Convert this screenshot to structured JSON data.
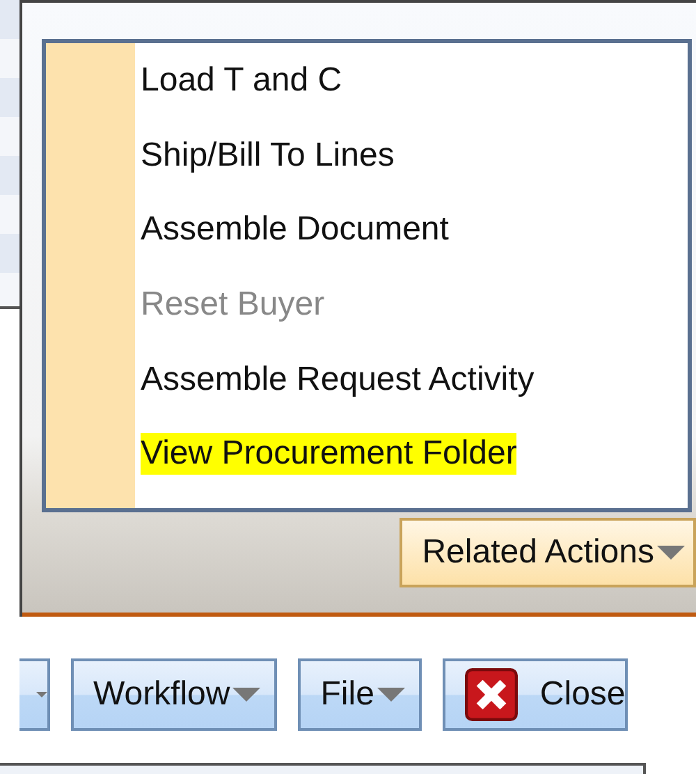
{
  "menu": {
    "items": [
      {
        "label": "Load T and C",
        "disabled": false,
        "highlighted": false
      },
      {
        "label": "Ship/Bill To Lines",
        "disabled": false,
        "highlighted": false
      },
      {
        "label": "Assemble Document",
        "disabled": false,
        "highlighted": false
      },
      {
        "label": "Reset Buyer",
        "disabled": true,
        "highlighted": false
      },
      {
        "label": "Assemble Request Activity",
        "disabled": false,
        "highlighted": false
      },
      {
        "label": "View Procurement Folder",
        "disabled": false,
        "highlighted": true
      }
    ]
  },
  "related_actions": {
    "label": "Related Actions",
    "expanded": true
  },
  "toolbar_buttons": [
    {
      "kind": "cut-off"
    },
    {
      "kind": "dropdown",
      "label": "Workflow"
    },
    {
      "kind": "dropdown",
      "label": "File"
    },
    {
      "kind": "close",
      "label": "Close"
    }
  ]
}
